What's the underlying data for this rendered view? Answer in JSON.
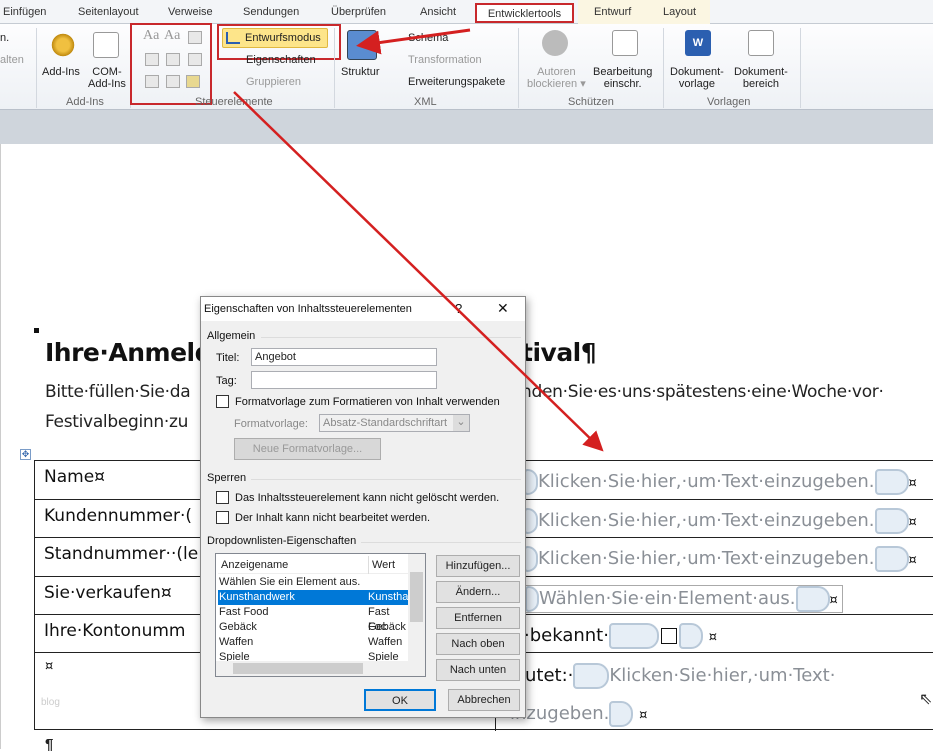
{
  "tabs": [
    "Einfügen",
    "Seitenlayout",
    "Verweise",
    "Sendungen",
    "Überprüfen",
    "Ansicht",
    "Entwicklertools",
    "Entwurf",
    "Layout"
  ],
  "ribbon": {
    "partial": [
      "n.",
      "alten"
    ],
    "addins": {
      "addins": "Add-Ins",
      "com1": "COM-",
      "com2": "Add-Ins",
      "group": "Add-Ins"
    },
    "controls": {
      "design_mode": "Entwurfsmodus",
      "properties": "Eigenschaften",
      "group_btn": "Gruppieren",
      "group": "Steuerelemente",
      "aa1": "Aa",
      "aa2": "Aa"
    },
    "xml": {
      "structure": "Struktur",
      "schema": "Schema",
      "transform": "Transformation",
      "packs": "Erweiterungspakete",
      "group": "XML"
    },
    "protect": {
      "authors1": "Autoren",
      "authors2": "blockieren",
      "restrict1": "Bearbeitung",
      "restrict2": "einschr.",
      "group": "Schützen"
    },
    "templates": {
      "doc1": "Dokument-",
      "doc2": "vorlage",
      "pane1": "Dokument-",
      "pane2": "bereich",
      "group": "Vorlagen"
    }
  },
  "document": {
    "heading_left": "Ihre·Anmeld",
    "heading_right": "tival¶",
    "para1_left": "Bitte·füllen·Sie·da",
    "para1_right": "nden·Sie·es·uns·spätestens·eine·Woche·vor·",
    "para2": "Festivalbeginn·zu",
    "rows": [
      {
        "label": "Name¤",
        "value": "Klicken·Sie·hier,·um·Text·einzugeben."
      },
      {
        "label": "Kundennummer·(",
        "value": "Klicken·Sie·hier,·um·Text·einzugeben."
      },
      {
        "label": "Standnummer··(le",
        "value": "Klicken·Sie·hier,·um·Text·einzugeben."
      },
      {
        "label": "Sie·verkaufen¤",
        "value": "Wählen·Sie·ein·Element·aus."
      },
      {
        "label": "Ihre·Kontonumm",
        "value": "·bekannt·"
      },
      {
        "label": "¤",
        "value": "utet:·",
        "value2": "Klicken·Sie·hier,·um·Text·",
        "value3": "inzugeben."
      }
    ],
    "cell_end": "¤",
    "watermark": "blog",
    "pilcrow": "¶"
  },
  "dialog": {
    "title": "Eigenschaften von Inhaltssteuerelementen",
    "help": "?",
    "close": "✕",
    "general": "Allgemein",
    "title_label": "Titel:",
    "title_value": "Angebot",
    "tag_label": "Tag:",
    "tag_value": "",
    "use_style": "Formatvorlage zum Formatieren von Inhalt verwenden",
    "style_label": "Formatvorlage:",
    "style_value": "Absatz-Standardschriftart",
    "new_style": "Neue Formatvorlage...",
    "locking": "Sperren",
    "lock1": "Das Inhaltssteuerelement kann nicht gelöscht werden.",
    "lock2": "Der Inhalt kann nicht bearbeitet werden.",
    "dropdown": "Dropdownlisten-Eigenschaften",
    "col_name": "Anzeigename",
    "col_value": "Wert",
    "items": [
      {
        "name": "Wählen Sie ein Element aus.",
        "value": ""
      },
      {
        "name": "Kunsthandwerk",
        "value": "Kunsthar"
      },
      {
        "name": "Fast Food",
        "value": "Fast Foc"
      },
      {
        "name": "Gebäck",
        "value": "Gebäck"
      },
      {
        "name": "Waffen",
        "value": "Waffen"
      },
      {
        "name": "Spiele",
        "value": "Spiele"
      }
    ],
    "selected_index": 1,
    "buttons": {
      "add": "Hinzufügen...",
      "edit": "Ändern...",
      "remove": "Entfernen",
      "up": "Nach oben",
      "down": "Nach unten",
      "ok": "OK",
      "cancel": "Abbrechen"
    }
  },
  "colors": {
    "highlight": "#c8282c",
    "selection": "#0078d7",
    "design_mode_bg": "#fde58a"
  }
}
